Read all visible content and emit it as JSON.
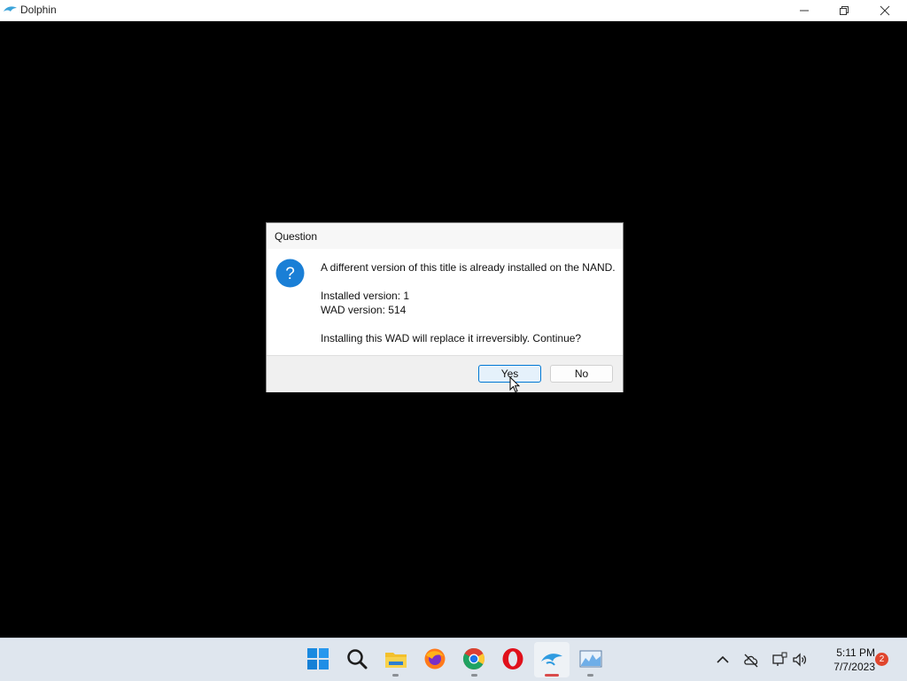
{
  "window": {
    "title": "Dolphin",
    "app_icon": "dolphin-icon",
    "controls": [
      "minimize-icon",
      "restore-icon",
      "close-icon"
    ]
  },
  "dialog": {
    "title": "Question",
    "icon": "question-icon",
    "message_line1": "A different version of this title is already installed on the NAND.",
    "installed_version": "Installed version: 1",
    "wad_version": "WAD version: 514",
    "confirm_line": "Installing this WAD will replace it irreversibly. Continue?",
    "yes_label": "Yes",
    "no_label": "No"
  },
  "taskbar": {
    "apps": [
      "windows-start-icon",
      "search-icon",
      "file-explorer-icon",
      "firefox-icon",
      "chrome-icon",
      "opera-icon",
      "dolphin-icon",
      "resource-monitor-icon"
    ],
    "tray": [
      "chevron-up-icon",
      "onedrive-offline-icon",
      "network-icon",
      "volume-icon"
    ],
    "time": "5:11 PM",
    "date": "7/7/2023",
    "notification_count": "2",
    "colors": {
      "accent": "#0078d4",
      "notification": "#e0462e"
    }
  }
}
